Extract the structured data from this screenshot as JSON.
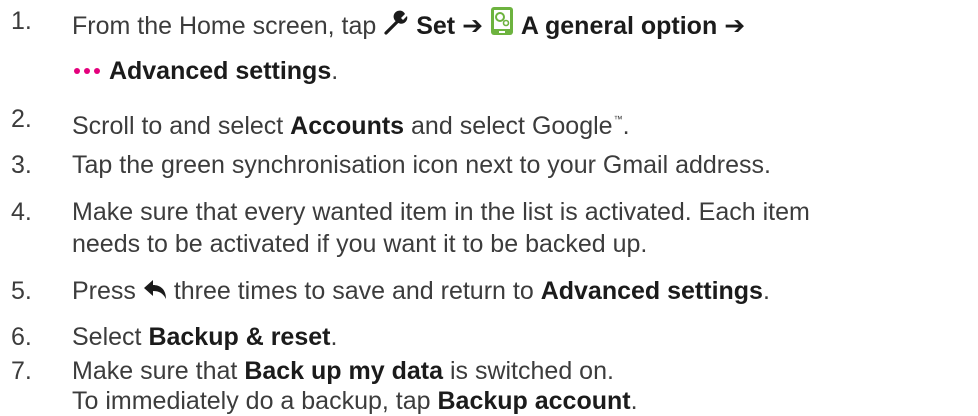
{
  "steps": [
    {
      "number": "1.",
      "intro": "From the Home screen, tap",
      "set_label": "Set",
      "general_label": "A general option",
      "advanced_label": "Advanced settings",
      "suffix": ".",
      "arrow": "➔"
    },
    {
      "number": "2.",
      "text_before": "Scroll to and select",
      "accounts": "Accounts",
      "text_mid": "and select Google",
      "tm": "™",
      "suffix": "."
    },
    {
      "number": "3.",
      "text": "Tap the green synchronisation icon next to your Gmail address."
    },
    {
      "number": "4.",
      "line1": "Make sure that every wanted item in the list is activated. Each item",
      "line2": "needs to be activated if you want it to be backed up."
    },
    {
      "number": "5.",
      "text_before": "Press",
      "text_after": "three times to save and return to",
      "target": "Advanced settings",
      "suffix": "."
    },
    {
      "number": "6.",
      "text_before": "Select",
      "target": "Backup & reset",
      "suffix": "."
    },
    {
      "number": "7.",
      "line1_before": "Make sure that",
      "line1_bold": "Back up my data",
      "line1_after": "is switched on.",
      "line2_before": "To immediately do a backup, tap",
      "line2_bold": "Backup account",
      "suffix": "."
    }
  ],
  "icons": {
    "settings_tool": "wrench-icon",
    "general_option": "device-settings-icon",
    "more_options": "three-dots-icon",
    "back": "back-arrow-icon"
  },
  "colors": {
    "text": "#3c3c3c",
    "bold_text": "#1b1b1b",
    "device_icon_green": "#6db33f",
    "dots_magenta": "#e4007c"
  }
}
